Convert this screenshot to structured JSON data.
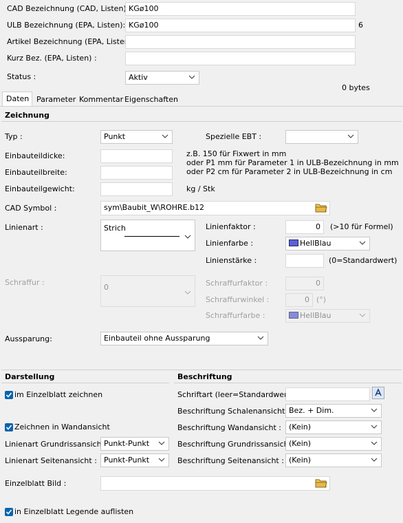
{
  "header": {
    "cad_label": "CAD Bezeichnung (CAD, Listen):",
    "cad_value": "KGø100",
    "ulb_label": "ULB Bezeichnung (EPA, Listen):",
    "ulb_value": "KGø100",
    "ulb_count": "6",
    "artikel_label": "Artikel Bezeichnung (EPA, Listen):",
    "artikel_value": "",
    "kurz_label": "Kurz Bez. (EPA, Listen) :",
    "kurz_value": "",
    "status_label": "Status :",
    "status_value": "Aktiv",
    "size_text": "0 bytes"
  },
  "tabs": [
    {
      "label": "Daten",
      "active": true
    },
    {
      "label": "Parameter",
      "active": false
    },
    {
      "label": "Kommentar",
      "active": false
    },
    {
      "label": "Eigenschaften",
      "active": false
    }
  ],
  "zeichnung": {
    "title": "Zeichnung",
    "typ_label": "Typ :",
    "typ_value": "Punkt",
    "ebt_label": "Spezielle EBT :",
    "ebt_value": "",
    "dicke_label": "Einbauteildicke:",
    "dicke_value": "",
    "breite_label": "Einbauteilbreite:",
    "breite_value": "",
    "gewicht_label": "Einbauteilgewicht:",
    "gewicht_value": "",
    "hint1": "z.B. 150 für Fixwert in mm",
    "hint2": "oder P1 mm für Parameter 1 in ULB-Bezeichnung in mm",
    "hint3": "oder P2 cm  für Parameter 2 in ULB-Bezeichnung in cm",
    "gewicht_unit": "kg / Stk",
    "symbol_label": "CAD Symbol :",
    "symbol_value": "sym\\Baubit_W\\ROHRE.b12",
    "linienart_label": "Linienart :",
    "linienart_value": "Strich",
    "linienfaktor_label": "Linienfaktor :",
    "linienfaktor_value": "0",
    "linienfaktor_hint": "(>10 für Formel)",
    "linienfarbe_label": "Linienfarbe :",
    "linienfarbe_value": "HellBlau",
    "linienstaerke_label": "Linienstärke :",
    "linienstaerke_value": "",
    "linienstaerke_hint": "(0=Standardwert)",
    "schraffur_label": "Schraffur :",
    "schraffur_value": "0",
    "schraffurfaktor_label": "Schraffurfaktor :",
    "schraffurfaktor_value": "0",
    "schraffurwinkel_label": "Schraffurwinkel :",
    "schraffurwinkel_value": "0",
    "schraffurwinkel_unit": "(°)",
    "schraffurfarbe_label": "Schraffurfarbe :",
    "schraffurfarbe_value": "HellBlau",
    "aussparung_label": "Aussparung:",
    "aussparung_value": "Einbauteil ohne Aussparung"
  },
  "darstellung": {
    "title": "Darstellung",
    "einzelblatt_label": "im Einzelblatt zeichnen",
    "einzelblatt_checked": true,
    "wandansicht_label": "Zeichnen in Wandansicht",
    "wandansicht_checked": true,
    "grundriss_label": "Linienart Grundrissansicht :",
    "grundriss_value": "Punkt-Punkt",
    "seiten_label": "Linienart Seitenansicht :",
    "seiten_value": "Punkt-Punkt",
    "bild_label": "Einzelblatt Bild :",
    "bild_value": "",
    "legende_label": "in Einzelblatt Legende auflisten",
    "legende_checked": true
  },
  "beschriftung": {
    "title": "Beschriftung",
    "schriftart_label": "Schriftart (leer=Standardwert) :",
    "schriftart_value": "",
    "schalen_label": "Beschriftung Schalenansicht :",
    "schalen_value": "Bez. + Dim.",
    "wand_label": "Beschriftung Wandansicht :",
    "wand_value": "(Kein)",
    "grundriss_label": "Beschriftung Grundrissansicht :",
    "grundriss_value": "(Kein)",
    "seiten_label": "Beschriftung Seitenansicht :",
    "seiten_value": "(Kein)"
  },
  "colors": {
    "hellblau": "#5b5fd6",
    "checkbox": "#0a64ad",
    "folder": "#e8b84a"
  },
  "icons": {
    "dropdown": "chevron-down-icon",
    "browse": "folder-icon",
    "font": "font-picker-icon"
  }
}
